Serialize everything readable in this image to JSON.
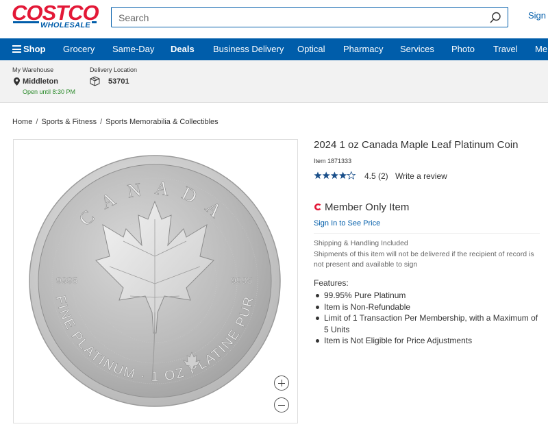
{
  "header": {
    "logo_top": "COSTCO",
    "logo_bottom": "WHOLESALE",
    "search_placeholder": "Search",
    "sign_in": "Sign I"
  },
  "nav": {
    "shop": "Shop",
    "items": [
      "Grocery",
      "Same-Day",
      "Deals",
      "Business Delivery",
      "Optical",
      "Pharmacy",
      "Services",
      "Photo",
      "Travel",
      "Me"
    ]
  },
  "warehouse": {
    "label": "My Warehouse",
    "name": "Middleton",
    "hours": "Open until 8:30 PM",
    "delivery_label": "Delivery Location",
    "delivery_zip": "53701"
  },
  "breadcrumb": [
    "Home",
    "Sports & Fitness",
    "Sports Memorabilia & Collectibles"
  ],
  "product": {
    "title": "2024 1 oz Canada Maple Leaf Platinum Coin",
    "item_label": "Item",
    "item_number": "1871333",
    "rating": "4.5",
    "rating_value": 4.5,
    "review_count": "(2)",
    "write_review": "Write a review",
    "member_only": "Member Only Item",
    "sign_in_price": "Sign In to See Price",
    "shipping": "Shipping & Handling Included",
    "shipping_note": "Shipments of this item will not be delivered if the recipient of record is not present and available to sign",
    "features_label": "Features:",
    "features": [
      "99.95% Pure Platinum",
      "Item is Non-Refundable",
      "Limit of 1 Transaction Per Membership, with a Maximum of 5 Units",
      "Item is Not Eligible for Price Adjustments"
    ]
  },
  "coin": {
    "top_text": "CANADA",
    "left_mark": "9995",
    "right_mark": "9995",
    "bottom_text": "FINE PLATINUM · 1 OZ PLATINE PUR"
  },
  "colors": {
    "brand_red": "#e31837",
    "brand_blue": "#005daa",
    "open_green": "#2a8a2a"
  }
}
